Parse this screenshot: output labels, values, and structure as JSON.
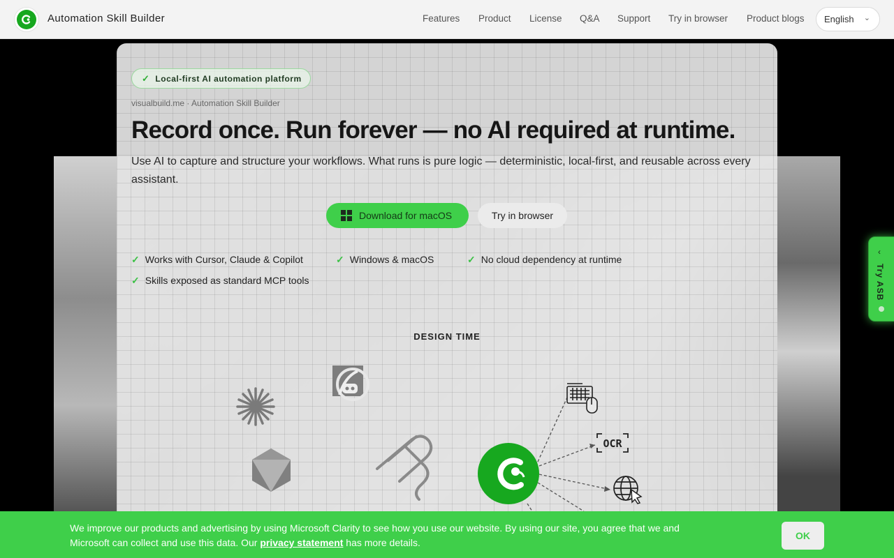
{
  "header": {
    "brand": "Automation Skill Builder",
    "nav": [
      "Features",
      "Product",
      "License",
      "Q&A",
      "Support",
      "Try in browser",
      "Product blogs"
    ],
    "language": "English"
  },
  "hero": {
    "badge": "Local-first AI automation platform",
    "breadcrumb": "visualbuild.me · Automation Skill Builder",
    "headline": "Record once. Run forever — no AI required at runtime.",
    "subline": "Use AI to capture and structure your workflows. What runs is pure logic — deterministic, local-first, and reusable across every assistant.",
    "download_label": "Download for macOS",
    "try_label": "Try in browser",
    "features": [
      "Works with Cursor, Claude & Copilot",
      "Windows & macOS",
      "No cloud dependency at runtime",
      "Skills exposed as standard MCP tools"
    ]
  },
  "diagram": {
    "section_label": "DESIGN TIME",
    "ocr_label": "OCR",
    "icons": [
      "claude-icon",
      "copilot-icon",
      "cursor-icon",
      "mcp-icon",
      "asb-logo-icon",
      "keyboard-mouse-icon",
      "ocr-icon",
      "web-cursor-icon"
    ]
  },
  "side_tab": {
    "label": "Try ASB"
  },
  "cookie": {
    "text_before": "We improve our products and advertising by using Microsoft Clarity to see how you use our website. By using our site, you agree that we and Microsoft can collect and use this data. Our ",
    "link_text": "privacy statement",
    "text_after": " has more details.",
    "ok_label": "OK"
  },
  "colors": {
    "accent": "#3fcf4a",
    "brand_dark": "#17a81f"
  }
}
